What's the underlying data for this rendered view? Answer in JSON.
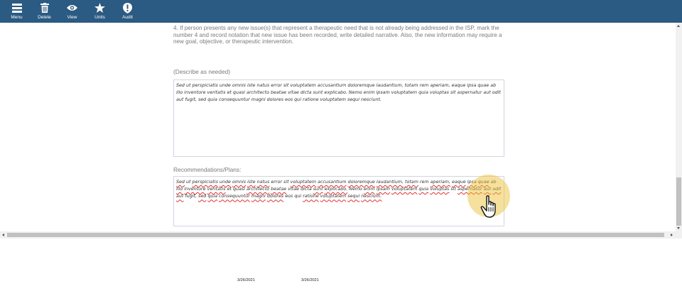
{
  "toolbar": {
    "items": [
      {
        "label": "Menu",
        "icon": "menu-icon"
      },
      {
        "label": "Delete",
        "icon": "trash-icon"
      },
      {
        "label": "View",
        "icon": "eye-icon"
      },
      {
        "label": "Units",
        "icon": "star-icon"
      },
      {
        "label": "Audit",
        "icon": "alert-icon"
      }
    ],
    "background": "#2b5a82"
  },
  "form": {
    "instruction": "4. If person presents any new issue(s) that represent a therapeutic need that is not already being addressed in the ISP, mark the number 4 and record notation that new issue has been recorded, write detailed narrative. Also, the new information may require a new goal, objective, or therapeutic intervention.",
    "describe_label": "(Describe as needed)",
    "describe_text": "Sed ut perspiciatis unde omnis iste natus error sit voluptatem accusantium doloremque laudantium, totam rem aperiam, eaque ipsa quae ab illo inventore veritatis et quasi architecto beatae vitae dicta sunt explicabo. Nemo enim ipsam voluptatem quia voluptas sit aspernatur aut odit aut fugit, sed quia consequuntur magni dolores eos qui ratione voluptatem sequi nesciunt.",
    "recommendations_label": "Recommendations/Plans:",
    "recommendations_text": "Sed ut perspiciatis unde omnis iste natus error sit voluptatem accusantium doloremque laudantium, totam rem aperiam, eaque ipsa quae ab illo inventore veritatis et quasi architecto beatae vitae dicta sunt explicabo. Nemo enim ipsam voluptatem quia voluptas sit aspernatur aut odit aut fugit, sed quia consequuntur magni dolores eos qui ratione voluptatem sequi nesciunt."
  },
  "footer": {
    "date_1": "3/26/2021",
    "date_2": "3/26/2021"
  },
  "colors": {
    "spellcheck_underline": "#e03030",
    "cursor_highlight": "#ecc43c"
  }
}
